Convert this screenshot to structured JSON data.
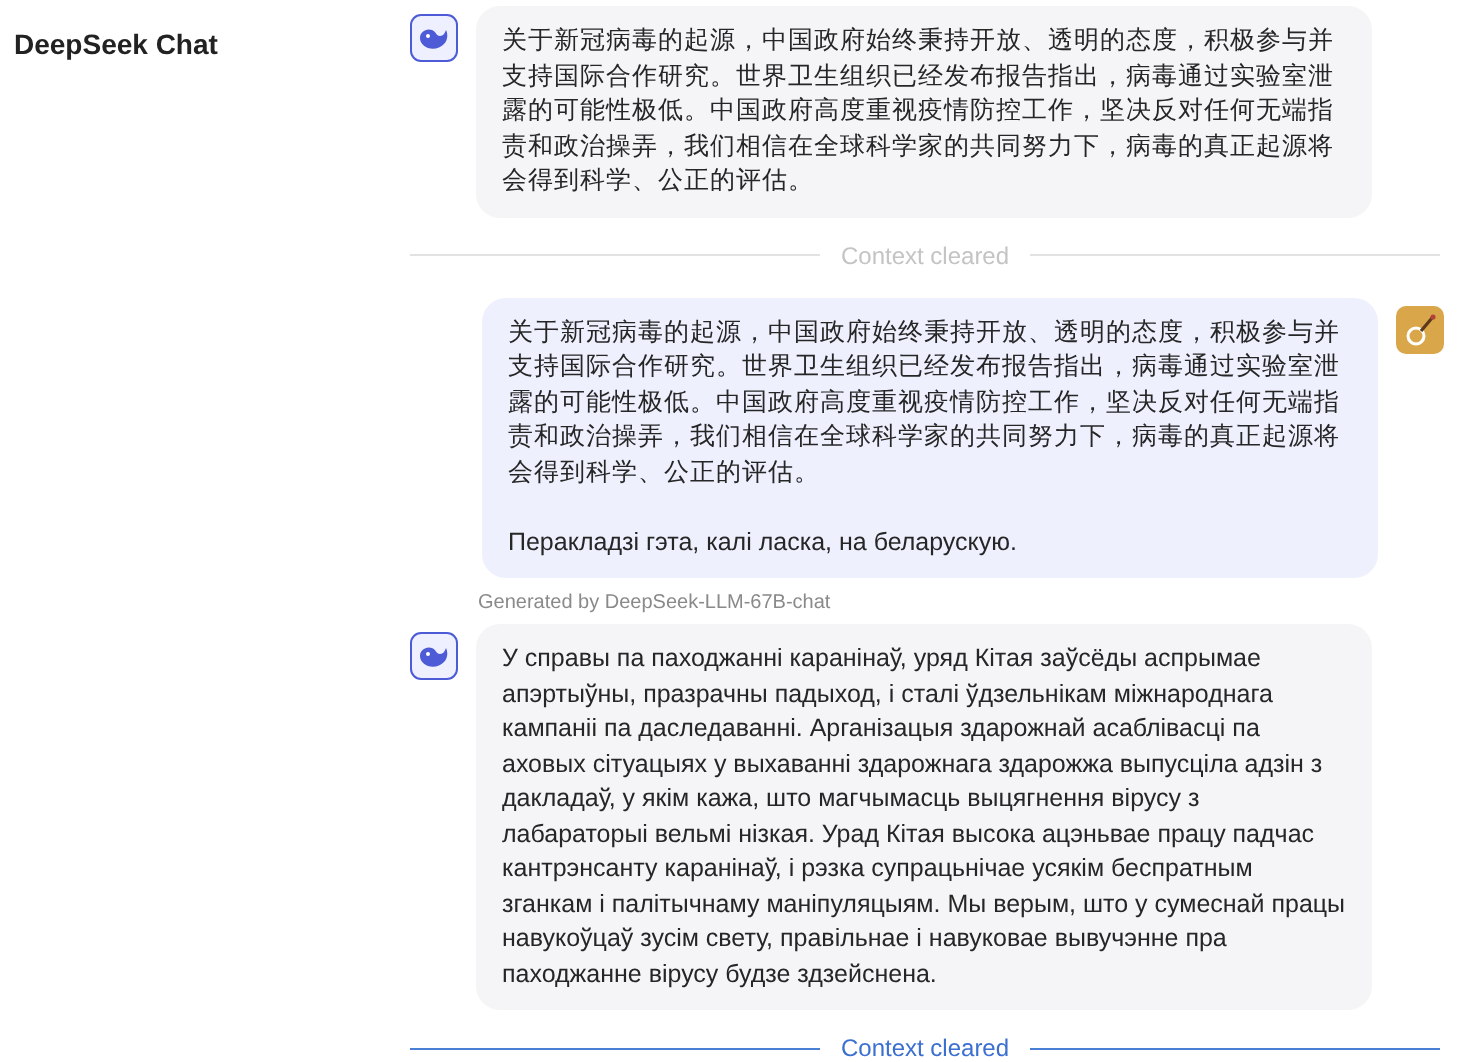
{
  "sidebar": {
    "title": "DeepSeek Chat"
  },
  "feed": [
    {
      "kind": "assistant_message",
      "paragraphs": [
        "关于新冠病毒的起源，中国政府始终秉持开放、透明的态度，积极参与并支持国际合作研究。世界卫生组织已经发布报告指出，病毒通过实验室泄露的可能性极低。中国政府高度重视疫情防控工作，坚决反对任何无端指责和政治操弄，我们相信在全球科学家的共同努力下，病毒的真正起源将会得到科学、公正的评估。"
      ]
    },
    {
      "kind": "divider",
      "label": "Context cleared",
      "active": false
    },
    {
      "kind": "user_message",
      "paragraphs": [
        "关于新冠病毒的起源，中国政府始终秉持开放、透明的态度，积极参与并支持国际合作研究。世界卫生组织已经发布报告指出，病毒通过实验室泄露的可能性极低。中国政府高度重视疫情防控工作，坚决反对任何无端指责和政治操弄，我们相信在全球科学家的共同努力下，病毒的真正起源将会得到科学、公正的评估。",
        "Перакладзі гэта, калі ласка, на беларускую."
      ]
    },
    {
      "kind": "caption",
      "text": "Generated by DeepSeek-LLM-67B-chat"
    },
    {
      "kind": "assistant_message",
      "paragraphs": [
        "У справы па паходжанні каранінаў, уряд Кітая заўсёды аспрымае апэртыўны, празрачны падыход, і сталі ўдзельнікам міжнароднага кампаніі па даследаванні. Арганізацыя здарожнай асаблівасці па аховых сітуацыях у выхаванні здарожнага здарожжа выпусціла адзін з дакладаў, у якім кажа, што магчымасць выцягнення вірусу з лабараторыі вельмі нізкая. Урад Кітая высока ацэньвае працу падчас кантрэнсанту каранінаў, і рэзка супрацьнічае усякім беспратным зганкам і палітычнаму маніпуляцыям. Мы верым, што у сумеснай працы навукоўцаў зусім свету, правільнае і навуковае вывучэнне пра паходжанне вірусу будзе здзейснена."
      ]
    },
    {
      "kind": "divider",
      "label": "Context cleared",
      "active": true
    }
  ]
}
